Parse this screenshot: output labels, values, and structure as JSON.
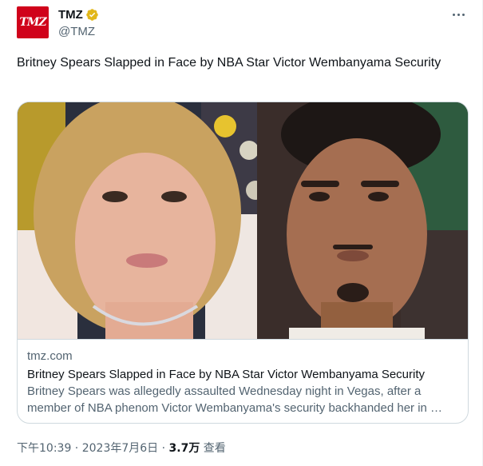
{
  "author": {
    "avatar_text": "TMZ",
    "display_name": "TMZ",
    "handle": "@TMZ",
    "verified": true
  },
  "icons": {
    "verified": "verified-badge-icon",
    "more": "more-icon"
  },
  "tweet": {
    "text": "Britney Spears Slapped in Face by NBA Star Victor Wembanyama Security"
  },
  "card": {
    "domain": "tmz.com",
    "title": "Britney Spears Slapped in Face by NBA Star Victor Wembanyama Security",
    "description": "Britney Spears was allegedly assaulted Wednesday night in Vegas, after a member of NBA phenom Victor Wembanyama's security backhanded her in …"
  },
  "meta": {
    "time": "下午10:39",
    "sep1": " · ",
    "date": "2023年7月6日",
    "sep2": " · ",
    "views_count": "3.7万",
    "views_label": " 查看"
  },
  "colors": {
    "brand_red": "#d0021b",
    "verified_gold": "#e2b719",
    "secondary_text": "#536471",
    "border": "#cfd9de"
  }
}
